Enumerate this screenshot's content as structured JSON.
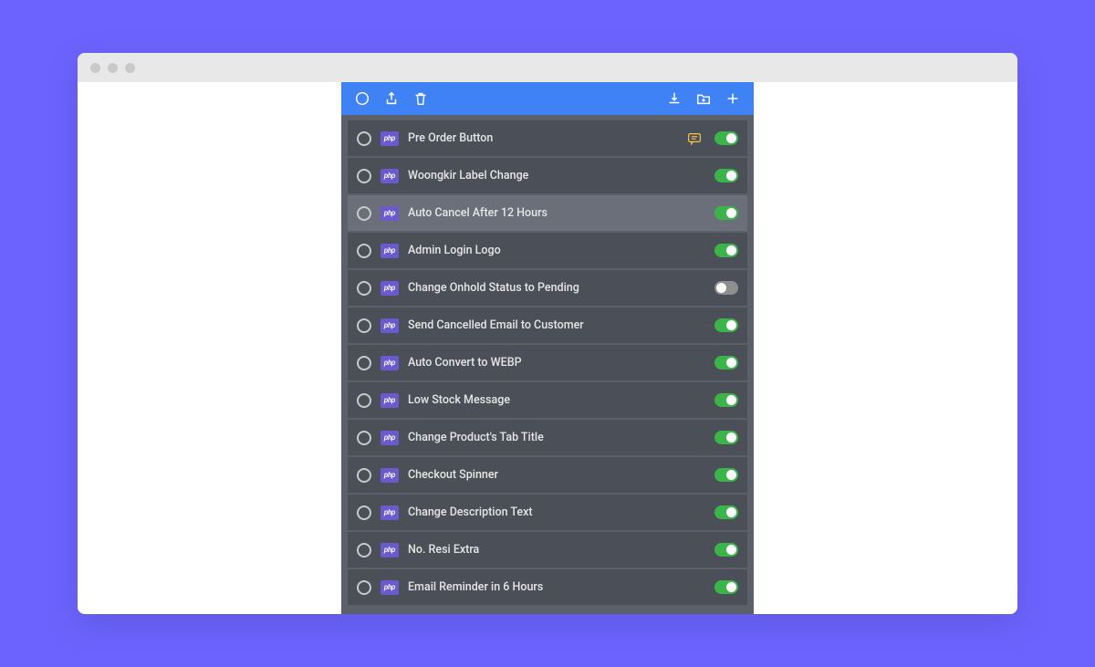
{
  "php_badge_text": "php",
  "items": [
    {
      "label": "Pre Order Button",
      "enabled": true,
      "selected": false,
      "has_note": true
    },
    {
      "label": "Woongkir Label Change",
      "enabled": true,
      "selected": false,
      "has_note": false
    },
    {
      "label": "Auto Cancel After 12 Hours",
      "enabled": true,
      "selected": true,
      "has_note": false
    },
    {
      "label": "Admin Login Logo",
      "enabled": true,
      "selected": false,
      "has_note": false
    },
    {
      "label": "Change Onhold Status to Pending",
      "enabled": false,
      "selected": false,
      "has_note": false
    },
    {
      "label": "Send Cancelled Email to Customer",
      "enabled": true,
      "selected": false,
      "has_note": false
    },
    {
      "label": "Auto Convert to WEBP",
      "enabled": true,
      "selected": false,
      "has_note": false
    },
    {
      "label": "Low Stock Message",
      "enabled": true,
      "selected": false,
      "has_note": false
    },
    {
      "label": "Change Product's Tab Title",
      "enabled": true,
      "selected": false,
      "has_note": false
    },
    {
      "label": "Checkout Spinner",
      "enabled": true,
      "selected": false,
      "has_note": false
    },
    {
      "label": "Change Description Text",
      "enabled": true,
      "selected": false,
      "has_note": false
    },
    {
      "label": "No. Resi Extra",
      "enabled": true,
      "selected": false,
      "has_note": false
    },
    {
      "label": "Email Reminder in 6 Hours",
      "enabled": true,
      "selected": false,
      "has_note": false
    }
  ]
}
